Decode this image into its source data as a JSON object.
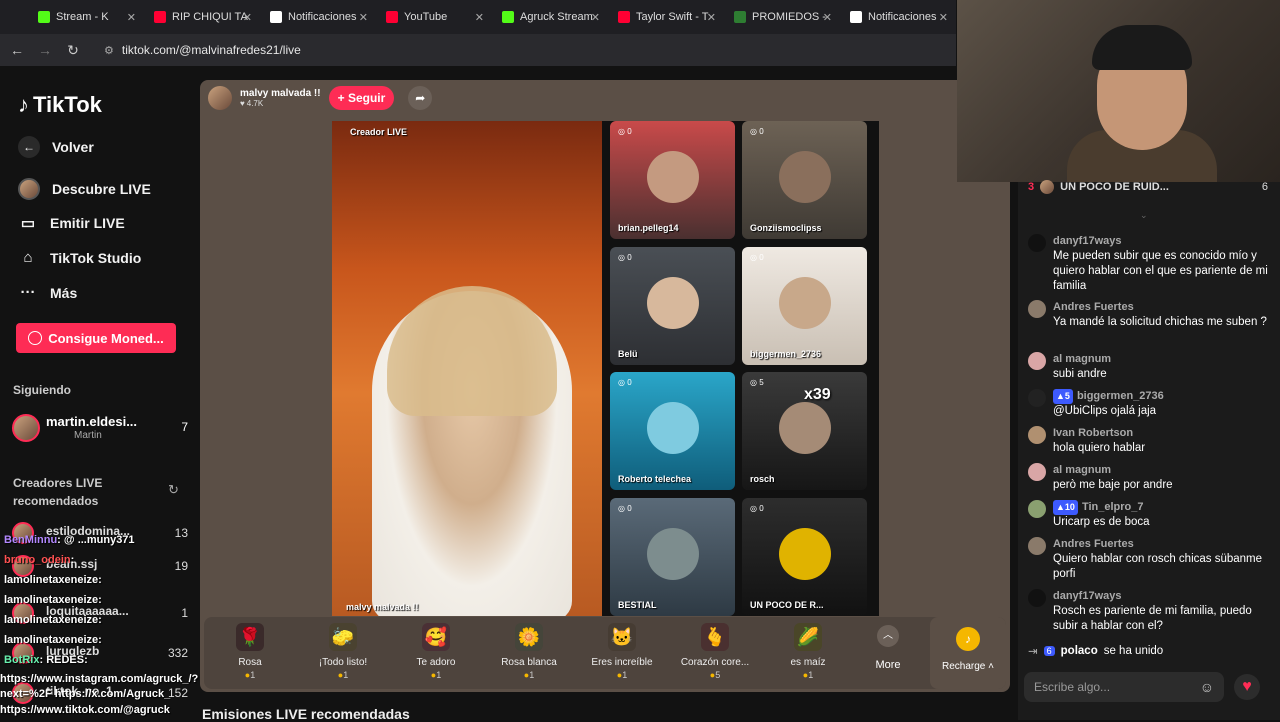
{
  "browser": {
    "tabs": [
      {
        "label": "Stream - K",
        "color": "#53fc18"
      },
      {
        "label": "RIP CHIQUI TA",
        "color": "#ff0033"
      },
      {
        "label": "Notificaciones",
        "color": "#ffffff"
      },
      {
        "label": "YouTube",
        "color": "#ff0033"
      },
      {
        "label": "Agruck Stream",
        "color": "#53fc18"
      },
      {
        "label": "Taylor Swift - T",
        "color": "#ff0033"
      },
      {
        "label": "PROMIEDOS -",
        "color": "#2e7d32"
      },
      {
        "label": "Notificaciones",
        "color": "#ffffff"
      }
    ],
    "url": "tiktok.com/@malvinafredes21/live"
  },
  "sidebar": {
    "logo": "TikTok",
    "back": "Volver",
    "nav": [
      {
        "label": "Descubre LIVE",
        "icon": "live-avatar-icon"
      },
      {
        "label": "Emitir LIVE",
        "icon": "camera-icon"
      },
      {
        "label": "TikTok Studio",
        "icon": "home-icon"
      },
      {
        "label": "Más",
        "icon": "more-icon"
      }
    ],
    "coins_button": "Consigue Moned...",
    "following_title": "Siguiendo",
    "following": {
      "name": "martin.eldesi...",
      "sub": "Martin",
      "count": "7"
    },
    "recommended_title": "Creadores LIVE recomendados",
    "recommended": [
      {
        "name": "estilodomina...",
        "count": "13"
      },
      {
        "name": "beam.ssj",
        "count": "19"
      },
      {
        "name": "loquitaaaaaa...",
        "count": "1"
      },
      {
        "name": "luruglezb",
        "count": "332"
      },
      {
        "name": "tiktok_no_1",
        "count": "152"
      }
    ]
  },
  "stream_chat_overlay": [
    {
      "user": "BenMinnu",
      "text": "@ ...muny371"
    },
    {
      "user": "bruno_odein",
      "text": ""
    },
    {
      "user": "lamolinetaxeneize",
      "text": ""
    },
    {
      "user": "lamolinetaxeneize",
      "text": ""
    },
    {
      "user": "lamolinetaxeneize",
      "text": ""
    },
    {
      "user": "lamolinetaxeneize",
      "text": ""
    },
    {
      "user": "BotRix",
      "text": "REDES:"
    },
    {
      "user": "",
      "text": "https://www.instagram.com/agruck_/?next=%2F https://x.com/Agruck_"
    },
    {
      "user": "",
      "text": "https://www.tiktok.com/@agruck"
    }
  ],
  "live": {
    "host_name": "malvy malvada !!",
    "viewers": "4.7K",
    "follow_label": "+ Seguir",
    "creator_label": "Creador LIVE",
    "host_watermark": "malvy malvada !!",
    "guests": [
      {
        "name": "brian.pelleg14",
        "badge": "0"
      },
      {
        "name": "Gonziismoclipss",
        "badge": "0"
      },
      {
        "name": "Belü",
        "badge": "0"
      },
      {
        "name": "biggermen_2736",
        "badge": "0"
      },
      {
        "name": "Roberto telechea",
        "badge": "0"
      },
      {
        "name": "rosch",
        "badge": "5",
        "multiplier": "x39"
      },
      {
        "name": "BESTIAL",
        "badge": "0"
      },
      {
        "name": "UN POCO DE R...",
        "badge": "0"
      }
    ]
  },
  "gifts": [
    {
      "name": "Rosa",
      "price": "1",
      "icon": "🌹"
    },
    {
      "name": "¡Todo listo!",
      "price": "1",
      "icon": "🧽"
    },
    {
      "name": "Te adoro",
      "price": "1",
      "icon": "🥰"
    },
    {
      "name": "Rosa blanca",
      "price": "1",
      "icon": "🌼"
    },
    {
      "name": "Eres increíble",
      "price": "1",
      "icon": "🐱"
    },
    {
      "name": "Corazón core...",
      "price": "5",
      "icon": "🫰"
    },
    {
      "name": "es maíz",
      "price": "1",
      "icon": "🌽"
    }
  ],
  "more_label": "More",
  "recharge_label": "Recharge",
  "recommended_streams_title": "Emisiones LIVE recomendadas",
  "chat": {
    "top_guest": {
      "rank": "3",
      "name": "UN POCO DE RUID...",
      "count": "6"
    },
    "messages": [
      {
        "user": "danyf17ways",
        "level": "",
        "text": "Me pueden subir que es conocido mío y quiero hablar con el que es pariente de mi familia"
      },
      {
        "user": "Andres Fuertes",
        "level": "",
        "text": "Ya mandé la solicitud chichas me suben ?"
      },
      {
        "user": "al magnum",
        "level": "",
        "text": "subi andre"
      },
      {
        "user": "biggermen_2736",
        "level": "5",
        "text": "@UbiClips ojalá jaja"
      },
      {
        "user": "Ivan Robertson",
        "level": "",
        "text": "hola quiero hablar"
      },
      {
        "user": "al magnum",
        "level": "",
        "text": "però me baje por andre"
      },
      {
        "user": "Tin_elpro_7",
        "level": "10",
        "text": "Uricarp es de boca"
      },
      {
        "user": "Andres Fuertes",
        "level": "",
        "text": "Quiero hablar con rosch chicas sübanme porfi"
      },
      {
        "user": "danyf17ways",
        "level": "",
        "text": "Rosch es pariente de mi familia, puedo subir a hablar con el?"
      }
    ],
    "joined": {
      "level": "6",
      "user": "polaco",
      "text": "se ha unido"
    },
    "input_placeholder": "Escribe algo..."
  }
}
